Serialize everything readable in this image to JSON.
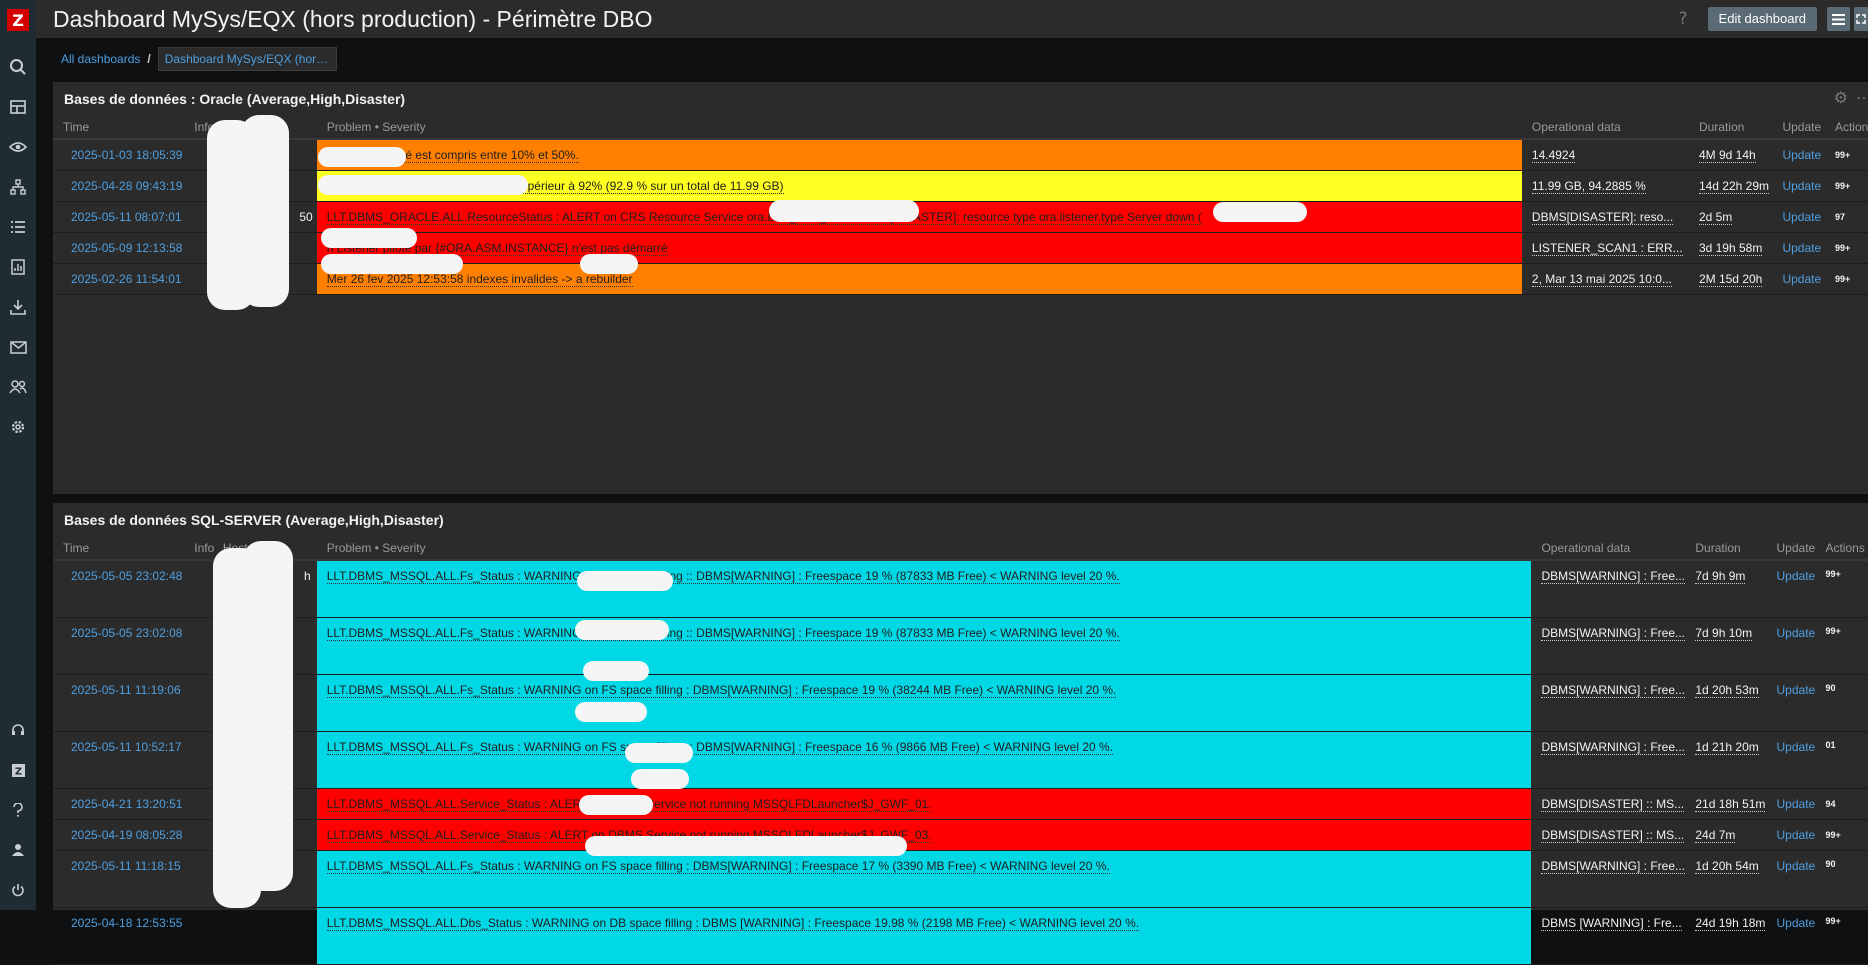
{
  "app": {
    "logo_letter": "Z",
    "accent": "#d40000"
  },
  "sidebar": {
    "top_icons": [
      "search-icon",
      "dashboard-icon",
      "monitoring-eye-icon",
      "network-icon",
      "list-icon",
      "reports-icon",
      "download-icon",
      "mail-icon",
      "users-icon",
      "gear-icon"
    ],
    "bottom_icons": [
      "support-headset-icon",
      "zabbix-share-icon",
      "help-icon",
      "user-icon",
      "power-icon"
    ]
  },
  "header": {
    "title": "Dashboard MySys/EQX (hors production) - Périmètre DBO",
    "help": "?",
    "edit_label": "Edit dashboard"
  },
  "breadcrumbs": {
    "all": "All dashboards",
    "sep": "/",
    "current": "Dashboard MySys/EQX (hors production) - Périmètre DBO"
  },
  "widget_oracle": {
    "title": "Bases de données : Oracle (Average,High,Disaster)",
    "columns": {
      "time": "Time",
      "info": "Info",
      "host": "Host",
      "problem": "Problem • Severity",
      "op": "Operational data",
      "duration": "Duration",
      "update": "Update",
      "actions": "Actions"
    },
    "rows": [
      {
        "time": "2025-01-03 18:05:39",
        "host": "",
        "problem": ": Le swap utilisé est compris entre 10% et 50%.",
        "op": "14.4924",
        "duration": "4M 9d 14h",
        "update": "Update",
        "actions": "99+",
        "severity": "average"
      },
      {
        "time": "2025-04-28 09:43:19",
        "host": "",
        "problem": ": L'espace utilisée du disque \"/\" est supérieur à 92% (92.9 % sur un total de 11.99 GB)",
        "op": "11.99 GB, 94.2885 %",
        "duration": "14d 22h 29m",
        "update": "Update",
        "actions": "99+",
        "severity": "warning"
      },
      {
        "time": "2025-05-11 08:07:01",
        "host": "50",
        "problem": "LLT.DBMS_ORACLE.ALL.ResourceStatus : ALERT on CRS Resource Service ora.LST_M44_EXT:  DBMS[DISASTER]: resource type ora.listener.type Server down (",
        "op": "DBMS[DISASTER]: reso...",
        "duration": "2d 5m",
        "update": "Update",
        "actions": "97",
        "severity": "high"
      },
      {
        "time": "2025-05-09 12:13:58",
        "host": "",
        "problem": "n Listener piloté par {#ORA.ASM.INSTANCE} n'est pas démarré",
        "op": "LISTENER_SCAN1 : ERR...",
        "duration": "3d 19h 58m",
        "update": "Update",
        "actions": "99+",
        "severity": "high"
      },
      {
        "time": "2025-02-26 11:54:01",
        "host": "",
        "problem": " Mer 26 fev 2025 12:53:58  indexes invalides -> a rebuilder",
        "op": "2, Mar 13 mai 2025 10:0...",
        "duration": "2M 15d 20h",
        "update": "Update",
        "actions": "99+",
        "severity": "average"
      }
    ]
  },
  "widget_sql": {
    "title": "Bases de données SQL-SERVER (Average,High,Disaster)",
    "columns": {
      "time": "Time",
      "info": "Info",
      "host": "Host ▲",
      "problem": "Problem • Severity",
      "op": "Operational data",
      "duration": "Duration",
      "update": "Update",
      "actions": "Actions"
    },
    "rows": [
      {
        "time": "2025-05-05 23:02:48",
        "host": "h",
        "problem": "LLT.DBMS_MSSQL.ALL.Fs_Status : WARNING on FS space filling  :: DBMS[WARNING] : Freespace  19 % (87833 MB Free) < WARNING level 20 %.",
        "op": "DBMS[WARNING] : Free...",
        "duration": "7d 9h 9m",
        "update": "Update",
        "actions": "99+",
        "severity": "info",
        "tall": true
      },
      {
        "time": "2025-05-05 23:02:08",
        "host": "",
        "problem": "LLT.DBMS_MSSQL.ALL.Fs_Status : WARNING on FS space filling  :: DBMS[WARNING] : Freespace  19 % (87833 MB Free) < WARNING level 20 %.",
        "op": "DBMS[WARNING] : Free...",
        "duration": "7d 9h 10m",
        "update": "Update",
        "actions": "99+",
        "severity": "info",
        "tall": true
      },
      {
        "time": "2025-05-11 11:19:06",
        "host": "",
        "problem": "LLT.DBMS_MSSQL.ALL.Fs_Status : WARNING on FS space filling  : DBMS[WARNING] : Freespace  19 % (38244 MB Free) < WARNING level 20 %.",
        "op": "DBMS[WARNING] : Free...",
        "duration": "1d 20h 53m",
        "update": "Update",
        "actions": "90",
        "severity": "info",
        "tall": true
      },
      {
        "time": "2025-05-11 10:52:17",
        "host": "",
        "problem": "LLT.DBMS_MSSQL.ALL.Fs_Status : WARNING on FS space filling  :: DBMS[WARNING] : Freespace  16 % (9866 MB Free) < WARNING level 20 %.",
        "op": "DBMS[WARNING] : Free...",
        "duration": "1d 21h 20m",
        "update": "Update",
        "actions": "01",
        "severity": "info",
        "tall": true
      },
      {
        "time": "2025-04-21 13:20:51",
        "host": "",
        "problem": "LLT.DBMS_MSSQL.ALL.Service_Status : ALERT on DBMS Service not running  MSSQLFDLauncher$J_GWF_01.",
        "op": "DBMS[DISASTER] :: MS...",
        "duration": "21d 18h 51m",
        "update": "Update",
        "actions": "94",
        "severity": "high",
        "tall": false
      },
      {
        "time": "2025-04-19 08:05:28",
        "host": "",
        "problem": "LLT.DBMS_MSSQL.ALL.Service_Status : ALERT on DBMS Service not running  MSSQLFDLauncher$J_GWF_03.",
        "op": "DBMS[DISASTER] :: MS...",
        "duration": "24d 7m",
        "update": "Update",
        "actions": "99+",
        "severity": "high",
        "tall": false
      },
      {
        "time": "2025-05-11 11:18:15",
        "host": "",
        "problem": "LLT.DBMS_MSSQL.ALL.Fs_Status : WARNING on FS space filling  : DBMS[WARNING] : Freespace  17 % (3390 MB Free) < WARNING level 20 %.",
        "op": "DBMS[WARNING] : Free...",
        "duration": "1d 20h 54m",
        "update": "Update",
        "actions": "90",
        "severity": "info",
        "tall": true
      },
      {
        "time": "2025-04-18 12:53:55",
        "host": "",
        "problem": "LLT.DBMS_MSSQL.ALL.Dbs_Status : WARNING on DB space filling  : DBMS [WARNING] : Freespace  19.98 % (2198 MB Free) < WARNING level 20 %.",
        "op": "DBMS [WARNING] : Fre...",
        "duration": "24d 19h 18m",
        "update": "Update",
        "actions": "99+",
        "severity": "info",
        "tall": true
      }
    ]
  },
  "colors": {
    "average": "#ff8000",
    "high": "#ff0000",
    "warning": "#ffff21",
    "info": "#00d8e6",
    "link": "#4f9fe0"
  }
}
